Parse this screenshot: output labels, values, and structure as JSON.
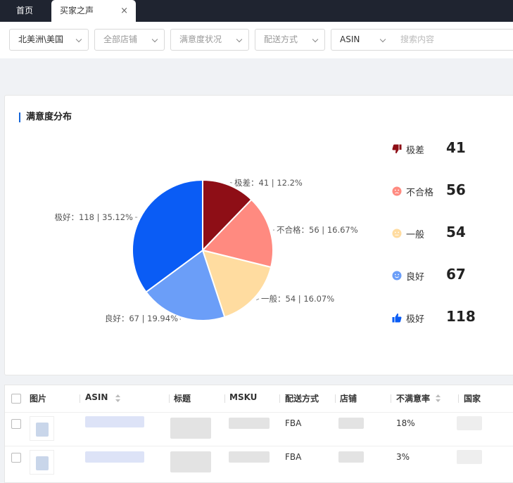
{
  "tabs": {
    "home": "首页",
    "active": "买家之声",
    "close": "×"
  },
  "filters": {
    "region": "北美洲\\美国",
    "stores": "全部店铺",
    "satisfaction": "满意度状况",
    "shipping": "配送方式",
    "field": "ASIN",
    "search_placeholder": "搜索内容"
  },
  "card": {
    "title": "满意度分布"
  },
  "chart_data": {
    "type": "pie",
    "slices": [
      {
        "name": "极差",
        "value": 41,
        "percent": "12.2%",
        "color": "#8e0e16"
      },
      {
        "name": "不合格",
        "value": 56,
        "percent": "16.67%",
        "color": "#ff8a80"
      },
      {
        "name": "一般",
        "value": 54,
        "percent": "16.07%",
        "color": "#ffdca0"
      },
      {
        "name": "良好",
        "value": 67,
        "percent": "19.94%",
        "color": "#6b9ef8"
      },
      {
        "name": "极好",
        "value": 118,
        "percent": "35.12%",
        "color": "#0a5cf5"
      }
    ],
    "labels": [
      "极差：41 | 12.2%",
      "不合格：56 | 16.67%",
      "一般：54 | 16.07%",
      "良好：67 | 19.94%",
      "极好：118 | 35.12%"
    ]
  },
  "legend": [
    {
      "icon": "thumbs-down-icon",
      "label": "极差",
      "count": "41",
      "color": "#8e0e16"
    },
    {
      "icon": "sad-face-icon",
      "label": "不合格",
      "count": "56",
      "color": "#ff8a80"
    },
    {
      "icon": "neutral-face-icon",
      "label": "一般",
      "count": "54",
      "color": "#ffdca0"
    },
    {
      "icon": "smile-face-icon",
      "label": "良好",
      "count": "67",
      "color": "#6b9ef8"
    },
    {
      "icon": "thumbs-up-icon",
      "label": "极好",
      "count": "118",
      "color": "#0a5cf5"
    }
  ],
  "table": {
    "headers": [
      "图片",
      "ASIN",
      "标题",
      "MSKU",
      "配送方式",
      "店铺",
      "不满意率",
      "国家"
    ],
    "rows": [
      {
        "shipping": "FBA",
        "rate": "18%"
      },
      {
        "shipping": "FBA",
        "rate": "3%"
      }
    ]
  }
}
